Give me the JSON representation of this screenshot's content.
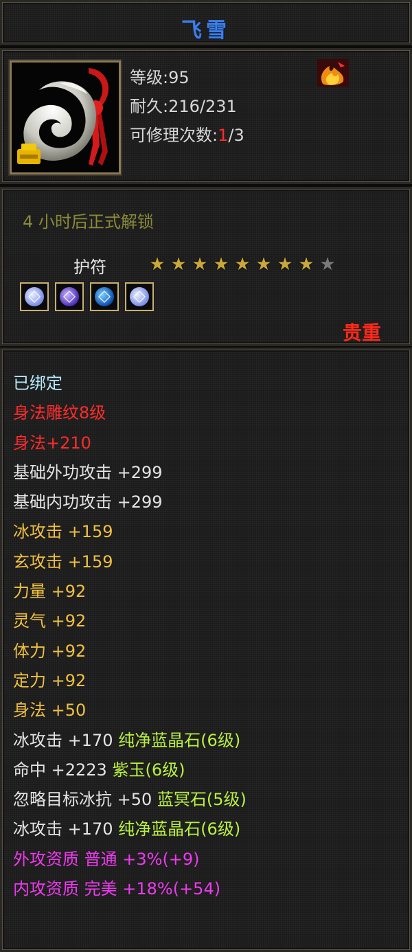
{
  "title": "飞雪",
  "info": {
    "level_label": "等级:",
    "level_value": "95",
    "durability_label": "耐久:",
    "durability_value": "216/231",
    "repair_label": "可修理次数:",
    "repair_current": "1",
    "repair_max": "/3"
  },
  "unlock_text": "4 小时后正式解锁",
  "amulet_label": "护符",
  "stars": {
    "filled": 8,
    "total": 9,
    "gold_color": "#c9a83a",
    "empty_color": "#7a7a7a"
  },
  "gems": [
    "white-gem-icon",
    "violet-gem-icon",
    "blue-gem-icon",
    "white-gem-icon"
  ],
  "rarity": "贵重",
  "attributes": [
    {
      "text": "已绑定",
      "color": "cyan"
    },
    {
      "text": "身法雕纹8级",
      "color": "red"
    },
    {
      "text": "身法+210",
      "color": "red"
    },
    {
      "text": "基础外功攻击 +299",
      "color": "white"
    },
    {
      "text": "基础内功攻击 +299",
      "color": "white"
    },
    {
      "text": "冰攻击 +159",
      "color": "yellow"
    },
    {
      "text": "玄攻击 +159",
      "color": "yellow"
    },
    {
      "text": "力量 +92",
      "color": "yellow"
    },
    {
      "text": "灵气 +92",
      "color": "yellow"
    },
    {
      "text": "体力 +92",
      "color": "yellow"
    },
    {
      "text": "定力 +92",
      "color": "yellow"
    },
    {
      "text": "身法 +50",
      "color": "yellow"
    },
    {
      "text": "冰攻击 +170",
      "color": "white",
      "gem": "纯净蓝晶石(6级)"
    },
    {
      "text": "命中 +2223",
      "color": "white",
      "gem": "紫玉(6级)"
    },
    {
      "text": "忽略目标冰抗 +50",
      "color": "white",
      "gem": "蓝冥石(5级)"
    },
    {
      "text": "冰攻击 +170",
      "color": "white",
      "gem": "纯净蓝晶石(6级)"
    },
    {
      "text": "外攻资质  普通 +3%(+9)",
      "color": "pink"
    },
    {
      "text": "内攻资质  完美 +18%(+54)",
      "color": "pink"
    }
  ]
}
